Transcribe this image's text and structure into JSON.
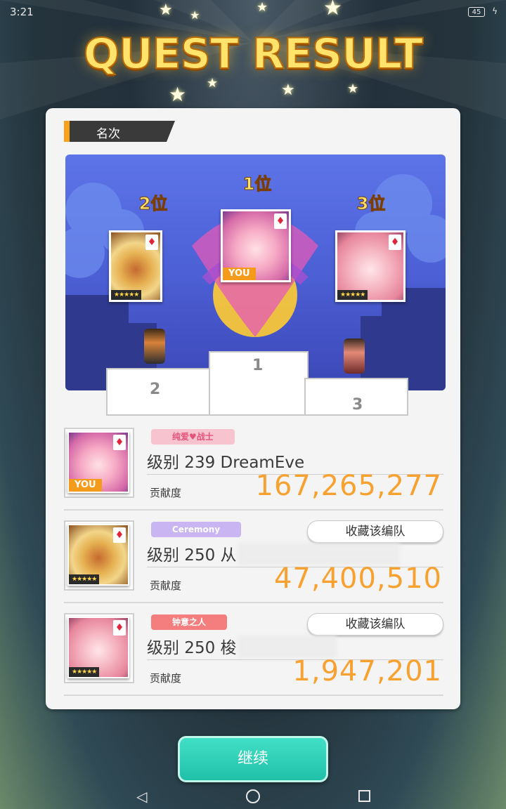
{
  "status_bar": {
    "time": "3:21",
    "battery": "45"
  },
  "header": {
    "title": "QUEST RESULT"
  },
  "panel": {
    "section_label": "名次"
  },
  "podium": {
    "ranks": [
      {
        "label": "2位",
        "stars": "★★★★★",
        "avatar": "lion-warrior"
      },
      {
        "label": "1位",
        "you_badge": "YOU",
        "avatar": "pink-girl"
      },
      {
        "label": "3位",
        "stars": "★★★★★",
        "avatar": "pink-rose-girl"
      }
    ],
    "step_numbers": [
      "2",
      "1",
      "3"
    ]
  },
  "results": [
    {
      "badge": "纯爱♥战士",
      "name": "级别 239 DreamEve",
      "contrib_label": "贡献度",
      "contrib_value": "167,265,277",
      "you_badge": "YOU",
      "badge_color": "#f7c3cf"
    },
    {
      "badge": "Ceremony",
      "name": "级别 250 从",
      "contrib_label": "贡献度",
      "contrib_value": "47,400,510",
      "stars": "★★★★★",
      "save_label": "收藏该编队",
      "badge_color": "#c9b5f2"
    },
    {
      "badge": "钟意之人",
      "name": "级别 250 梭",
      "contrib_label": "贡献度",
      "contrib_value": "1,947,201",
      "stars": "★★★★★",
      "save_label": "收藏该编队",
      "badge_color": "#f47d7d"
    }
  ],
  "footer": {
    "continue_label": "继续"
  },
  "colors": {
    "accent": "#f7a230",
    "continue": "#20bfa8",
    "panel": "#f4f4f4"
  }
}
